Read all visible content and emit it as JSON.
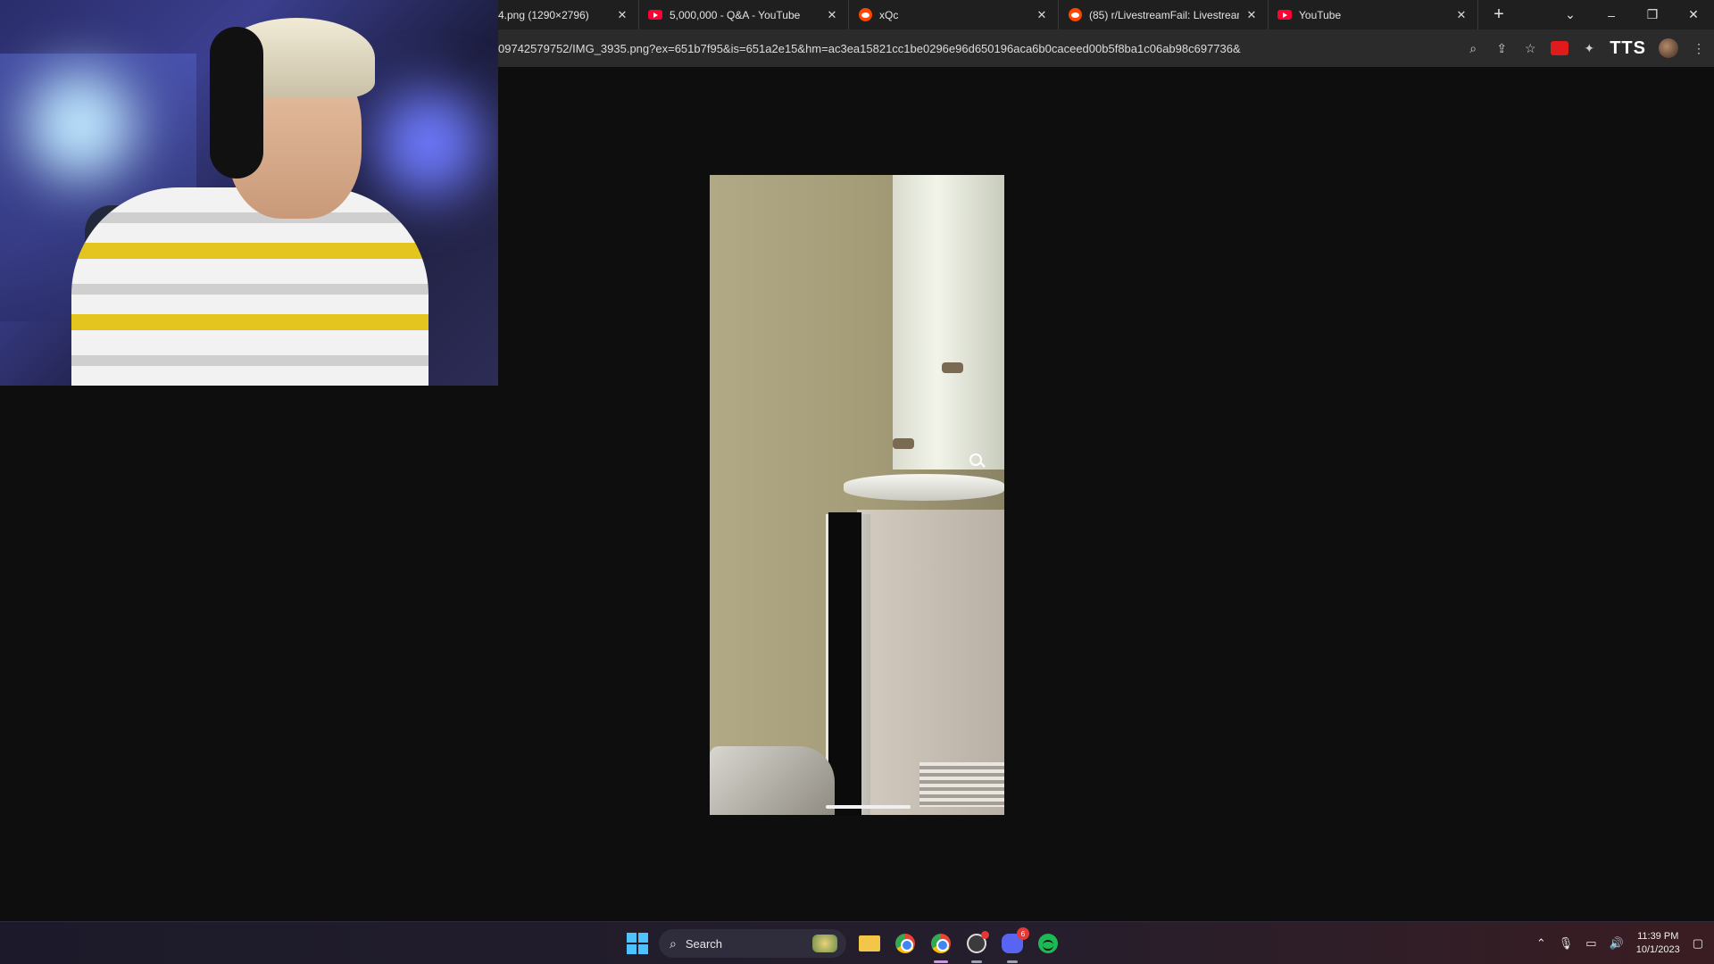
{
  "browser": {
    "tabs": [
      {
        "label": "4.png (1290×2796)",
        "favicon": "none-icon"
      },
      {
        "label": "5,000,000 - Q&A - YouTube",
        "favicon": "youtube-icon"
      },
      {
        "label": "xQc",
        "favicon": "reddit-icon"
      },
      {
        "label": "(85) r/LivestreamFail: Livestrean",
        "favicon": "reddit-icon"
      },
      {
        "label": "YouTube",
        "favicon": "youtube-icon"
      }
    ],
    "new_tab": "+",
    "url": "09742579752/IMG_3935.png?ex=651b7f95&is=651a2e15&hm=ac3ea15821cc1be0296e96d650196aca6b0caceed00b5f8ba1c06ab98c697736&",
    "tts_label": "TTS",
    "colors": {
      "tab_bg": "#1f1f1f",
      "toolbar_bg": "#2b2b2b",
      "page_bg": "#0e0e0e"
    }
  },
  "taskbar": {
    "search_label": "Search",
    "discord_badge": "6",
    "time": "11:39 PM",
    "date": "10/1/2023"
  }
}
